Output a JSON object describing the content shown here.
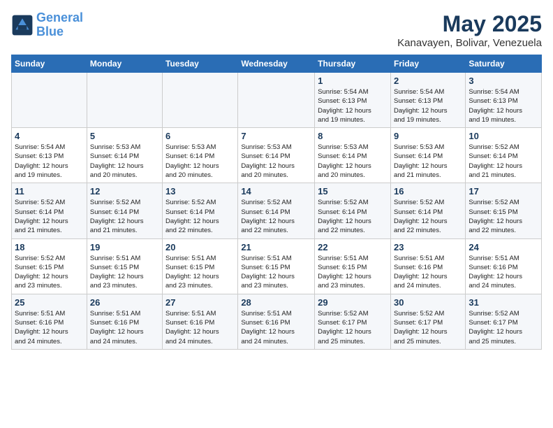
{
  "header": {
    "logo_line1": "General",
    "logo_line2": "Blue",
    "month_title": "May 2025",
    "location": "Kanavayen, Bolivar, Venezuela"
  },
  "weekdays": [
    "Sunday",
    "Monday",
    "Tuesday",
    "Wednesday",
    "Thursday",
    "Friday",
    "Saturday"
  ],
  "weeks": [
    [
      {
        "day": "",
        "info": ""
      },
      {
        "day": "",
        "info": ""
      },
      {
        "day": "",
        "info": ""
      },
      {
        "day": "",
        "info": ""
      },
      {
        "day": "1",
        "info": "Sunrise: 5:54 AM\nSunset: 6:13 PM\nDaylight: 12 hours\nand 19 minutes."
      },
      {
        "day": "2",
        "info": "Sunrise: 5:54 AM\nSunset: 6:13 PM\nDaylight: 12 hours\nand 19 minutes."
      },
      {
        "day": "3",
        "info": "Sunrise: 5:54 AM\nSunset: 6:13 PM\nDaylight: 12 hours\nand 19 minutes."
      }
    ],
    [
      {
        "day": "4",
        "info": "Sunrise: 5:54 AM\nSunset: 6:13 PM\nDaylight: 12 hours\nand 19 minutes."
      },
      {
        "day": "5",
        "info": "Sunrise: 5:53 AM\nSunset: 6:14 PM\nDaylight: 12 hours\nand 20 minutes."
      },
      {
        "day": "6",
        "info": "Sunrise: 5:53 AM\nSunset: 6:14 PM\nDaylight: 12 hours\nand 20 minutes."
      },
      {
        "day": "7",
        "info": "Sunrise: 5:53 AM\nSunset: 6:14 PM\nDaylight: 12 hours\nand 20 minutes."
      },
      {
        "day": "8",
        "info": "Sunrise: 5:53 AM\nSunset: 6:14 PM\nDaylight: 12 hours\nand 20 minutes."
      },
      {
        "day": "9",
        "info": "Sunrise: 5:53 AM\nSunset: 6:14 PM\nDaylight: 12 hours\nand 21 minutes."
      },
      {
        "day": "10",
        "info": "Sunrise: 5:52 AM\nSunset: 6:14 PM\nDaylight: 12 hours\nand 21 minutes."
      }
    ],
    [
      {
        "day": "11",
        "info": "Sunrise: 5:52 AM\nSunset: 6:14 PM\nDaylight: 12 hours\nand 21 minutes."
      },
      {
        "day": "12",
        "info": "Sunrise: 5:52 AM\nSunset: 6:14 PM\nDaylight: 12 hours\nand 21 minutes."
      },
      {
        "day": "13",
        "info": "Sunrise: 5:52 AM\nSunset: 6:14 PM\nDaylight: 12 hours\nand 22 minutes."
      },
      {
        "day": "14",
        "info": "Sunrise: 5:52 AM\nSunset: 6:14 PM\nDaylight: 12 hours\nand 22 minutes."
      },
      {
        "day": "15",
        "info": "Sunrise: 5:52 AM\nSunset: 6:14 PM\nDaylight: 12 hours\nand 22 minutes."
      },
      {
        "day": "16",
        "info": "Sunrise: 5:52 AM\nSunset: 6:14 PM\nDaylight: 12 hours\nand 22 minutes."
      },
      {
        "day": "17",
        "info": "Sunrise: 5:52 AM\nSunset: 6:15 PM\nDaylight: 12 hours\nand 22 minutes."
      }
    ],
    [
      {
        "day": "18",
        "info": "Sunrise: 5:52 AM\nSunset: 6:15 PM\nDaylight: 12 hours\nand 23 minutes."
      },
      {
        "day": "19",
        "info": "Sunrise: 5:51 AM\nSunset: 6:15 PM\nDaylight: 12 hours\nand 23 minutes."
      },
      {
        "day": "20",
        "info": "Sunrise: 5:51 AM\nSunset: 6:15 PM\nDaylight: 12 hours\nand 23 minutes."
      },
      {
        "day": "21",
        "info": "Sunrise: 5:51 AM\nSunset: 6:15 PM\nDaylight: 12 hours\nand 23 minutes."
      },
      {
        "day": "22",
        "info": "Sunrise: 5:51 AM\nSunset: 6:15 PM\nDaylight: 12 hours\nand 23 minutes."
      },
      {
        "day": "23",
        "info": "Sunrise: 5:51 AM\nSunset: 6:16 PM\nDaylight: 12 hours\nand 24 minutes."
      },
      {
        "day": "24",
        "info": "Sunrise: 5:51 AM\nSunset: 6:16 PM\nDaylight: 12 hours\nand 24 minutes."
      }
    ],
    [
      {
        "day": "25",
        "info": "Sunrise: 5:51 AM\nSunset: 6:16 PM\nDaylight: 12 hours\nand 24 minutes."
      },
      {
        "day": "26",
        "info": "Sunrise: 5:51 AM\nSunset: 6:16 PM\nDaylight: 12 hours\nand 24 minutes."
      },
      {
        "day": "27",
        "info": "Sunrise: 5:51 AM\nSunset: 6:16 PM\nDaylight: 12 hours\nand 24 minutes."
      },
      {
        "day": "28",
        "info": "Sunrise: 5:51 AM\nSunset: 6:16 PM\nDaylight: 12 hours\nand 24 minutes."
      },
      {
        "day": "29",
        "info": "Sunrise: 5:52 AM\nSunset: 6:17 PM\nDaylight: 12 hours\nand 25 minutes."
      },
      {
        "day": "30",
        "info": "Sunrise: 5:52 AM\nSunset: 6:17 PM\nDaylight: 12 hours\nand 25 minutes."
      },
      {
        "day": "31",
        "info": "Sunrise: 5:52 AM\nSunset: 6:17 PM\nDaylight: 12 hours\nand 25 minutes."
      }
    ]
  ]
}
